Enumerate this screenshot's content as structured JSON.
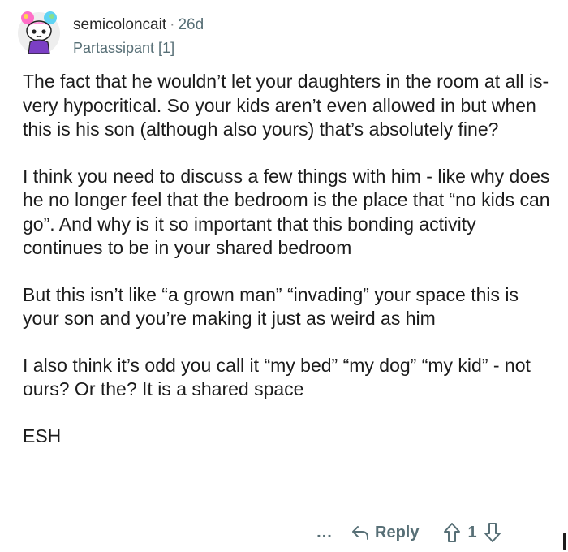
{
  "comment": {
    "author": "semicoloncait",
    "separator": "·",
    "age": "26d",
    "flair": "Partassipant [1]",
    "paragraphs": [
      "The fact that he wouldn’t let your daughters in the room at all is-very hypocritical. So your kids aren’t even allowed in but when this is his son (although also yours) that’s absolutely fine?",
      "I think you need to discuss a few things with him - like why does he no longer feel that the bedroom is the place that “no kids can go”. And why is it so important that this bonding activity continues to be in your shared bedroom",
      "But this isn’t like “a grown man” “invading” your space this is your son and you’re making it just as weird as him",
      "I also think it’s odd you call it “my bed” “my dog” “my kid” - not ours? Or the? It is a shared space",
      "ESH"
    ]
  },
  "actions": {
    "more_label": "...",
    "reply_label": "Reply",
    "vote_count": "1"
  },
  "icons": {
    "avatar": "snoo-avatar-icon",
    "reply": "reply-arrow-icon",
    "upvote": "upvote-arrow-icon",
    "downvote": "downvote-arrow-icon"
  }
}
